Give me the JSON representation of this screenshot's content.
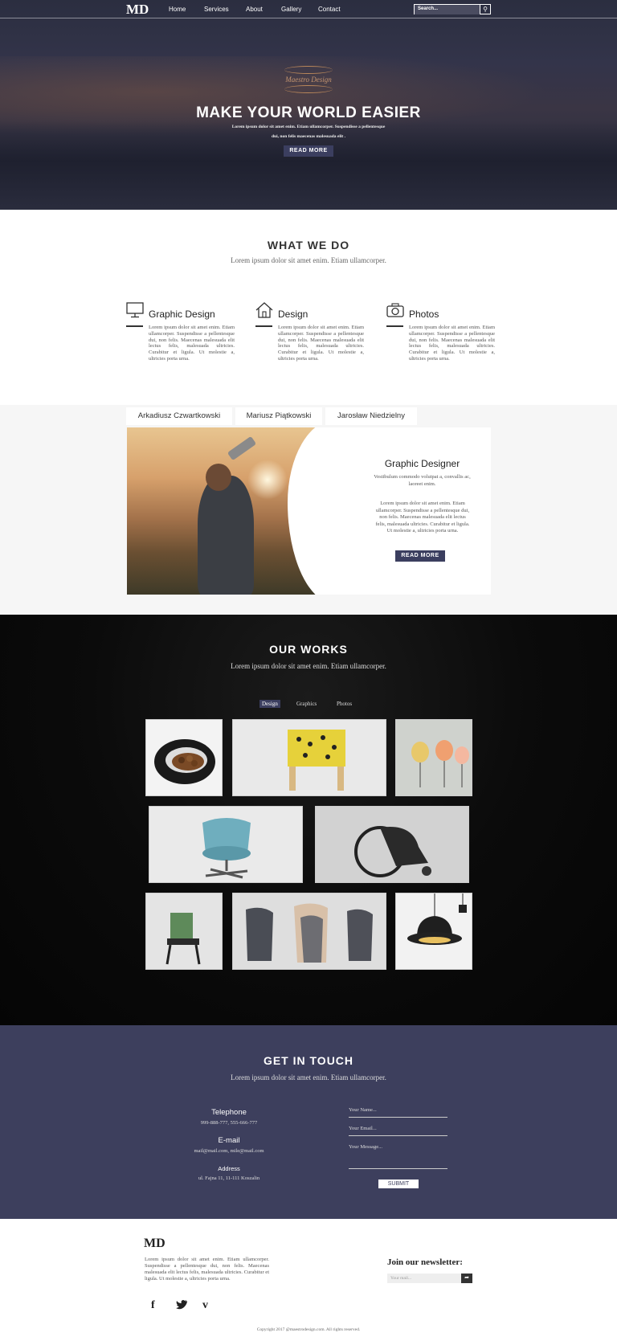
{
  "header": {
    "logo": "MD",
    "nav": [
      "Home",
      "Services",
      "About",
      "Gallery",
      "Contact"
    ],
    "search_placeholder": "Search..."
  },
  "hero": {
    "emblem_text": "Maestro Design",
    "title": "MAKE YOUR WORLD EASIER",
    "subtitle": "Lorem ipsum dolor sit amet enim. Etiam ullamcorper. Suspendisse a pellentesque dui, non felis maecenas malesuada elit .",
    "button": "READ MORE"
  },
  "what_we_do": {
    "title": "WHAT WE DO",
    "subtitle": "Lorem ipsum dolor sit amet enim. Etiam ullamcorper.",
    "services": [
      {
        "icon": "monitor-icon",
        "title": "Graphic Design",
        "text": "Lorem ipsum dolor sit amet enim. Etiam ullamcorper. Suspendisse a pellentesque dui, non felis. Maecenas malesuada elit lectus felis, malesuada ultricies. Curabitur et ligula. Ut molestie a, ultricies porta urna."
      },
      {
        "icon": "house-icon",
        "title": "Design",
        "text": "Lorem ipsum dolor sit amet enim. Etiam ullamcorper. Suspendisse a pellentesque dui, non felis. Maecenas malesuada elit lectus felis, malesuada ultricies. Curabitur et ligula. Ut molestie a, ultricies porta urna."
      },
      {
        "icon": "camera-icon",
        "title": "Photos",
        "text": "Lorem ipsum dolor sit amet enim. Etiam ullamcorper. Suspendisse a pellentesque dui, non felis. Maecenas malesuada elit lectus felis, malesuada ultricies. Curabitur et ligula. Ut molestie a, ultricies porta urna."
      }
    ]
  },
  "team": {
    "tabs": [
      "Arkadiusz Czwartkowski",
      "Mariusz Piątkowski",
      "Jarosław Niedzielny"
    ],
    "role": "Graphic Designer",
    "role_sub": "Vestibulum commodo volutpat a, convallis ac, laoreet enim.",
    "text": "Lorem ipsum dolor sit amet enim. Etiam ullamcorper. Suspendisse a pellentesque dui, non felis. Maecenas malesuada elit lectus felis, malesuada ultricies. Curabitur et ligula. Ut molestie a, ultricies porta urna.",
    "button": "READ MORE"
  },
  "works": {
    "title": "OUR WORKS",
    "subtitle": "Lorem ipsum dolor sit amet enim. Etiam ullamcorper.",
    "filters": [
      "Design",
      "Graphics",
      "Photos"
    ],
    "active_filter": "Design"
  },
  "contact": {
    "title": "GET IN TOUCH",
    "subtitle": "Lorem ipsum dolor sit amet enim. Etiam ullamcorper.",
    "telephone_label": "Telephone",
    "telephone": "999-888-777, 555-666-777",
    "email_label": "E-mail",
    "email": "mail@mail.com, mile@mail.com",
    "address_label": "Address",
    "address": "ul. Fajna 11, 11-111 Koszalin",
    "name_placeholder": "Your Name...",
    "email_placeholder": "Your Email...",
    "message_placeholder": "Your Message...",
    "submit": "SUBMIT"
  },
  "footer": {
    "logo": "MD",
    "text": "Lorem ipsum dolor sit amet enim. Etiam ullamcorper. Suspendisse a pellentesque dui, non felis. Maecenas malesuada elit lectus felis, malesuada ultricies. Curabitur et ligula. Ut molestie a, ultricies porta urna.",
    "newsletter_title": "Join our newsletter:",
    "newsletter_placeholder": "Your mail...",
    "copyright": "Copyright 2017 @maestrodesign.com. All rights reserved.",
    "social": [
      "facebook-icon",
      "twitter-icon",
      "vimeo-icon"
    ]
  },
  "colors": {
    "accent": "#3b3e5f",
    "contact_bg": "#3d3f5d",
    "emblem": "#c59570"
  }
}
